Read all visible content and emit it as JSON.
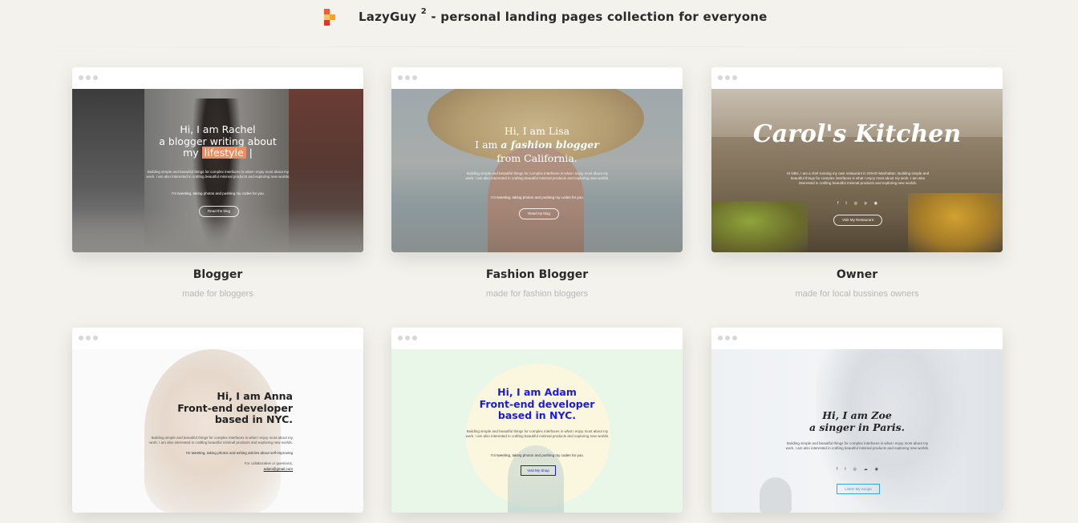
{
  "header": {
    "brand": "LazyGuy",
    "version": "2",
    "tagline": "- personal landing pages collection for everyone",
    "logo_colors": [
      "#f25a34",
      "#f7a12c",
      "#e8312b"
    ]
  },
  "templates": [
    {
      "title": "Blogger",
      "subtitle": "made for bloggers",
      "preview": {
        "line1": "Hi, I am Rachel",
        "line2": "a blogger writing about",
        "line3_prefix": "my",
        "highlight": "lifestyle",
        "body": "Building simple and beautiful things for complex interfaces is what I enjoy most about my work. I am also interested in crafting beautiful minimal products and exploring new worlds.",
        "links": "I'm tweeting, taking photos and pushing my codes for you.",
        "button": "Read the blog",
        "accent": "#f28b5b"
      }
    },
    {
      "title": "Fashion Blogger",
      "subtitle": "made for fashion bloggers",
      "preview": {
        "line1": "Hi, I am Lisa",
        "line2_prefix": "I am",
        "line2_em": "a fashion blogger",
        "line3": "from California.",
        "body": "Building simple and beautiful things for complex interfaces is what I enjoy most about my work. I am also interested in crafting beautiful minimal products and exploring new worlds.",
        "links": "I'm tweeting, taking photos and pushing my codes for you.",
        "button": "Read my blog"
      }
    },
    {
      "title": "Owner",
      "subtitle": "made for local bussines owners",
      "preview": {
        "logo_text": "Carol's Kitchen",
        "body": "Hi folks, I am a chef running my own restaurant in SOHO Manhattan. Building simple and beautiful things for complex interfaces is what I enjoy most about my work. I am also interested in crafting beautiful minimal products and exploring new worlds.",
        "button": "Visit My Restaurant"
      }
    },
    {
      "title": "",
      "subtitle": "",
      "preview": {
        "line1": "Hi, I am Anna",
        "line2": "Front-end developer",
        "line3": "based in NYC.",
        "body": "Building simple and beautiful things for complex interfaces is what I enjoy most about my work. I am also interested in crafting beautiful minimal products and exploring new worlds.",
        "links": "I'm tweeting, taking photos and writing articles about self-improving",
        "contact": "For collaborative or questions,",
        "email": "adam@gmail.com"
      }
    },
    {
      "title": "",
      "subtitle": "",
      "preview": {
        "line1": "Hi, I am Adam",
        "line2": "Front-end developer",
        "line3": "based in NYC.",
        "body": "Building simple and beautiful things for complex interfaces is what I enjoy most about my work. I am also interested in crafting beautiful minimal products and exploring new worlds.",
        "links": "I'm tweeting, taking photos and pushing my codes for you.",
        "button": "Visit My Shop",
        "accent": "#1a1ae6"
      }
    },
    {
      "title": "",
      "subtitle": "",
      "preview": {
        "line1": "Hi, I am Zoe",
        "line2": "a singer in Paris.",
        "body": "Building simple and beautiful things for complex interfaces is what I enjoy most about my work. I am also interested in crafting beautiful minimal products and exploring new worlds.",
        "button": "Listen My Songs",
        "accent": "#3aa0e8"
      }
    }
  ]
}
